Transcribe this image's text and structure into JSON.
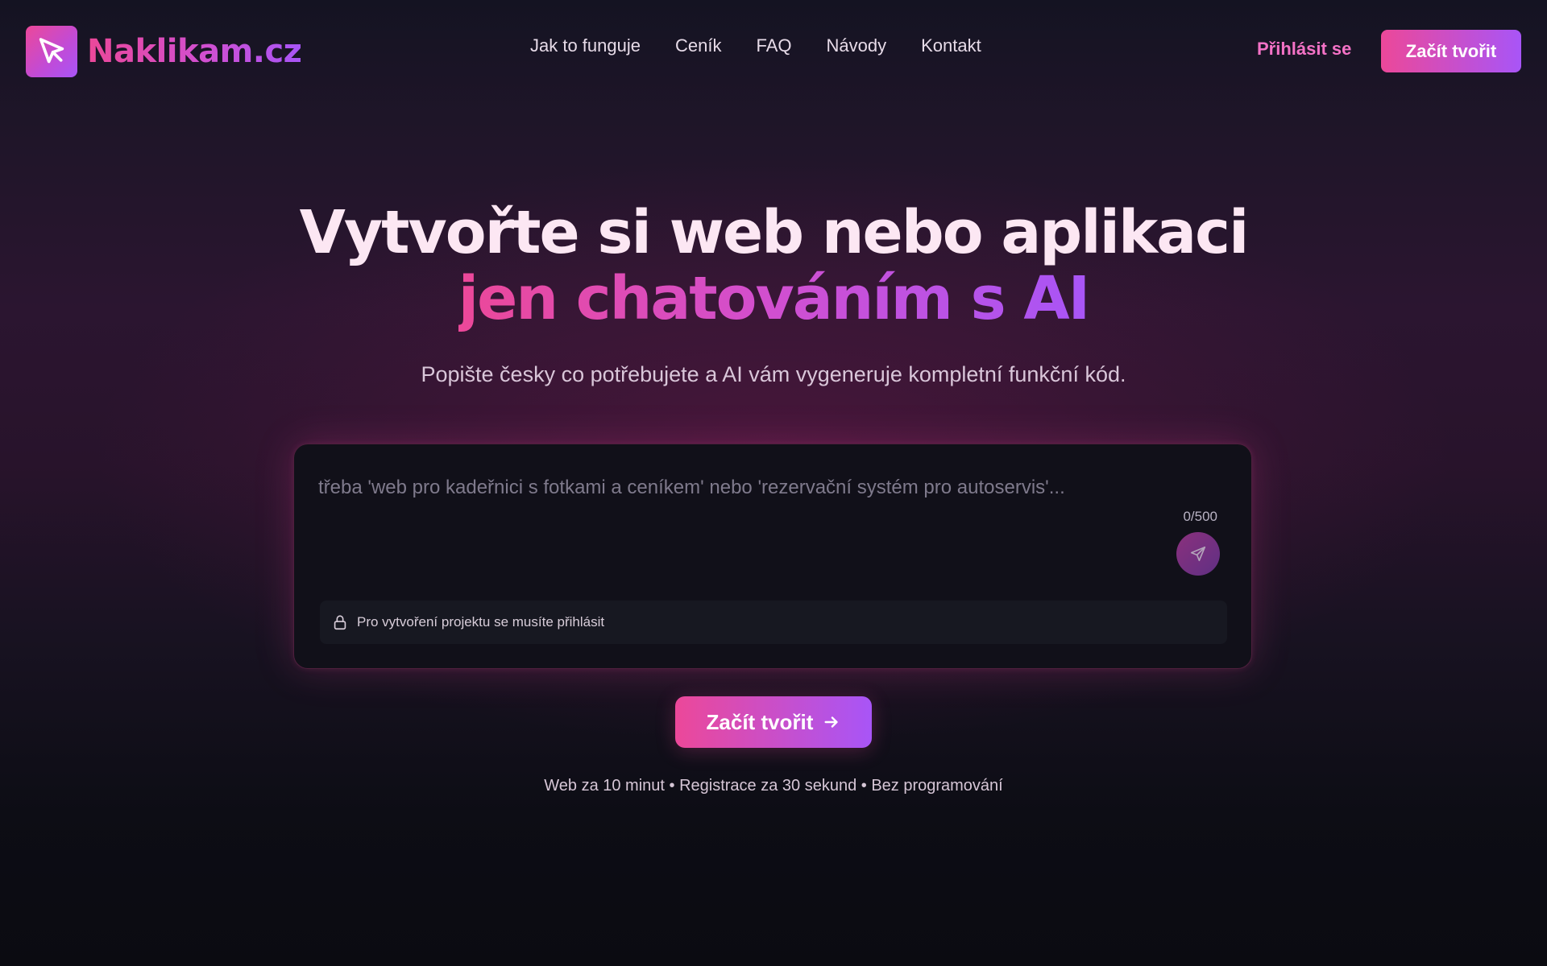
{
  "brand": {
    "name": "Naklikam.cz",
    "logo_icon": "cursor-arrow-icon",
    "gradient_start": "#ec4899",
    "gradient_end": "#a855f7"
  },
  "nav": {
    "items": [
      {
        "label": "Jak to funguje"
      },
      {
        "label": "Ceník"
      },
      {
        "label": "FAQ"
      },
      {
        "label": "Návody"
      },
      {
        "label": "Kontakt"
      }
    ],
    "login_label": "Přihlásit se",
    "cta_label": "Začít tvořit"
  },
  "hero": {
    "title_line1": "Vytvořte si web nebo aplikaci",
    "title_line2": "jen chatováním s AI",
    "subtitle": "Popište česky co potřebujete a AI vám vygeneruje kompletní funkční kód."
  },
  "prompt": {
    "value": "",
    "placeholder": "třeba 'web pro kadeřnici s fotkami a ceníkem' nebo 'rezervační systém pro autoservis'...",
    "char_count": "0/500",
    "send_icon": "send-icon",
    "login_notice": "Pro vytvoření projektu se musíte přihlásit",
    "notice_icon": "lock-icon"
  },
  "cta": {
    "label": "Začít tvořit",
    "icon": "arrow-right-icon",
    "tagline": "Web za 10 minut • Registrace za 30 sekund • Bez programování"
  }
}
